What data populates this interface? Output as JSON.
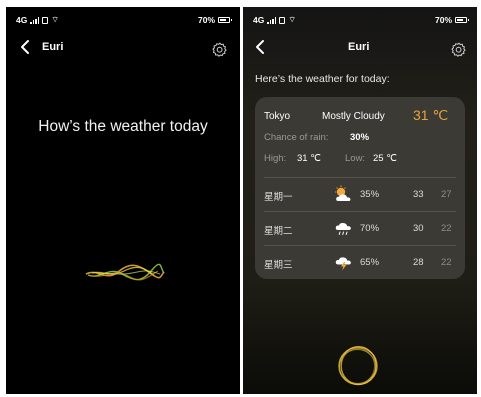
{
  "colors": {
    "accent": "#e6a43a",
    "card": "#3b3a35",
    "wave_orange": "#e9a23b",
    "wave_green": "#9fd63a"
  },
  "status_bar": {
    "network": "4G",
    "battery": "70%"
  },
  "screen1": {
    "title": "Euri",
    "back_icon": "chevron-left-icon",
    "settings_icon": "gear-icon",
    "headline": "How’s the weather today",
    "voice_icon": "voice-wave-icon"
  },
  "screen2": {
    "title": "Euri",
    "intro": "Here’s the weather for today:",
    "card": {
      "city": "Tokyo",
      "condition": "Mostly Cloudy",
      "temperature": "31 ℃",
      "rain_label": "Chance of rain:",
      "rain_value": "30%",
      "high_label": "High:",
      "high_value": "31 ℃",
      "low_label": "Low:",
      "low_value": "25 ℃"
    },
    "forecast": [
      {
        "day": "星期一",
        "icon": "sun-cloud-icon",
        "rain": "35%",
        "high": "33",
        "low": "27"
      },
      {
        "day": "星期二",
        "icon": "rain-cloud-icon",
        "rain": "70%",
        "high": "30",
        "low": "22"
      },
      {
        "day": "星期三",
        "icon": "thunder-cloud-icon",
        "rain": "65%",
        "high": "28",
        "low": "22"
      }
    ],
    "mic_icon": "voice-ring-icon"
  }
}
